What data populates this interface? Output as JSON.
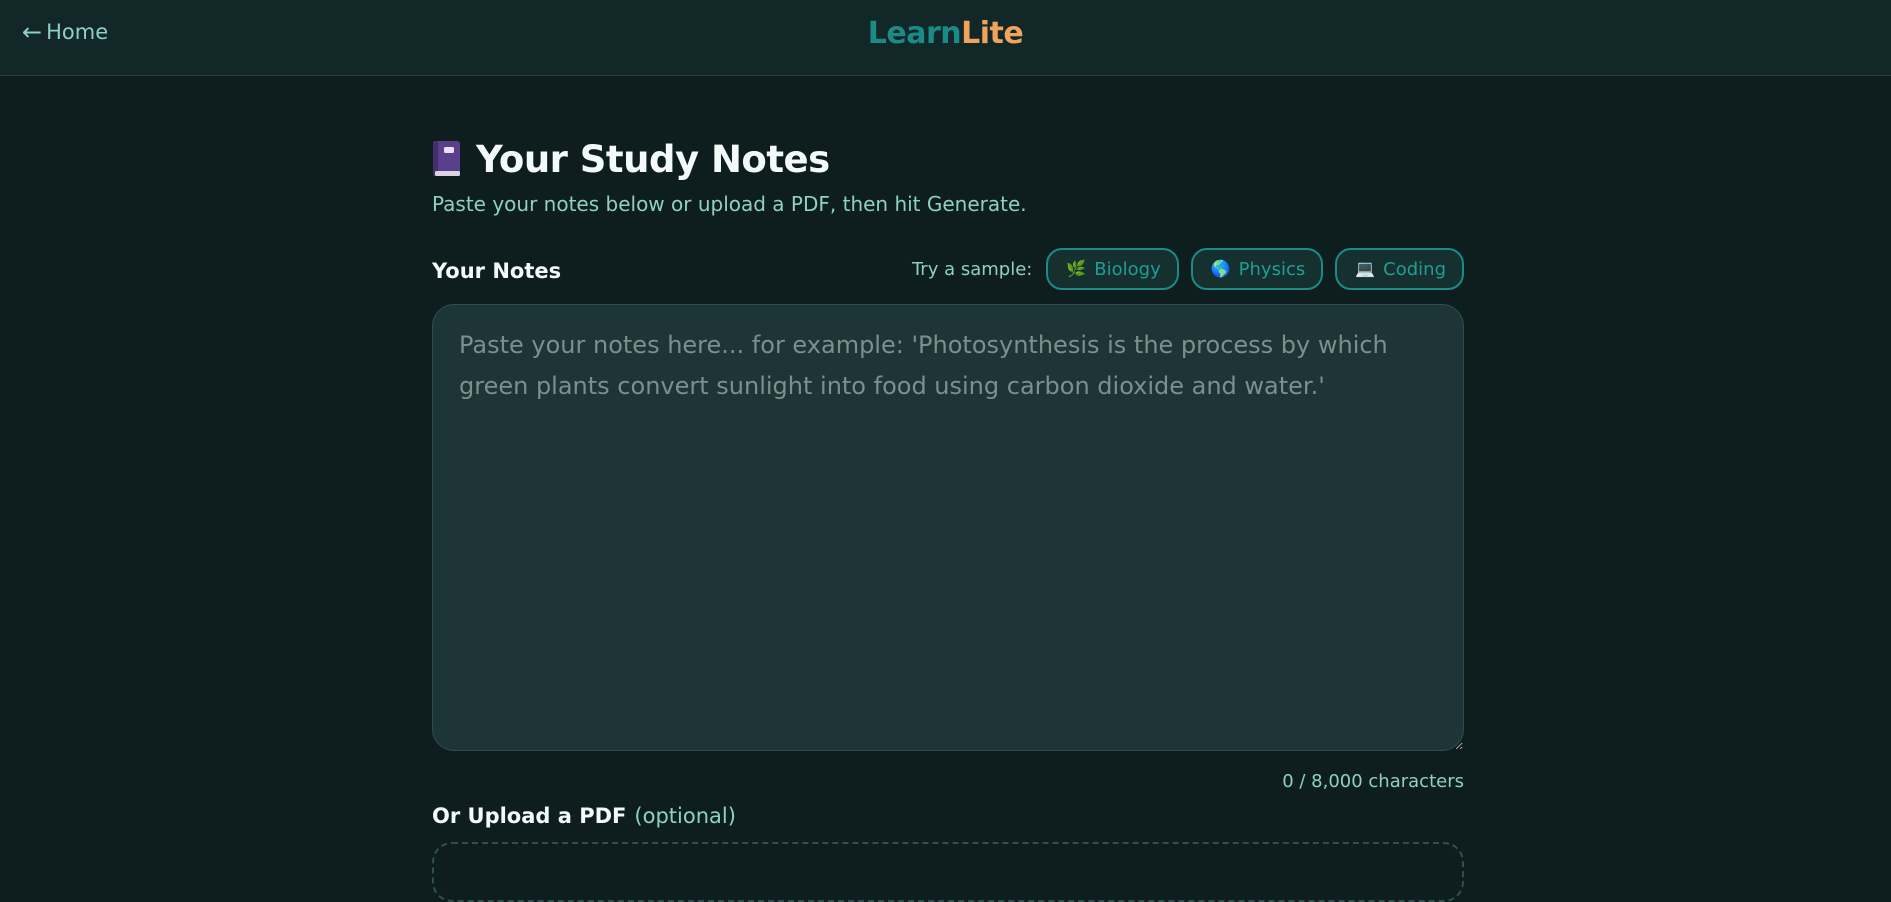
{
  "header": {
    "back_arrow": "←",
    "back_label": "Home",
    "logo_part1": "Learn",
    "logo_part2": "Lite"
  },
  "main": {
    "title": "Your Study Notes",
    "title_icon": "book-icon",
    "subtitle": "Paste your notes below or upload a PDF, then hit Generate.",
    "notes_label": "Your Notes",
    "try_label": "Try a sample:",
    "samples": [
      {
        "label": "Biology",
        "icon": "🌿"
      },
      {
        "label": "Physics",
        "icon": "🌎"
      },
      {
        "label": "Coding",
        "icon": "💻"
      }
    ],
    "notes_value": "",
    "notes_placeholder": "Paste your notes here... for example: 'Photosynthesis is the process by which green plants convert sunlight into food using carbon dioxide and water.'",
    "char_count": "0 / 8,000 characters",
    "upload_label": "Or Upload a PDF",
    "upload_optional": "(optional)"
  },
  "colors": {
    "background": "#0e1e1f",
    "header_bg": "#122728",
    "accent_teal": "#1a8b86",
    "accent_orange": "#f0a35b",
    "muted_text": "#8fd0c6"
  }
}
